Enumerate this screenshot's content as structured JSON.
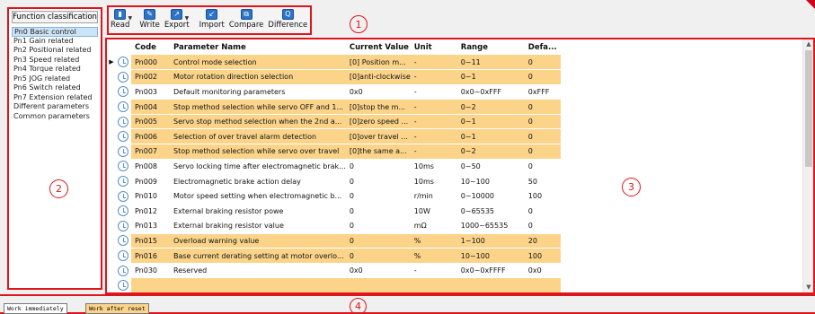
{
  "toolbar": {
    "buttons": [
      {
        "label": "Read",
        "icon": "read-icon",
        "has_dropdown": true
      },
      {
        "label": "Write",
        "icon": "write-icon",
        "has_dropdown": false
      },
      {
        "label": "Export",
        "icon": "export-icon",
        "has_dropdown": true
      },
      {
        "label": "Import",
        "icon": "import-icon",
        "has_dropdown": false
      },
      {
        "label": "Compare",
        "icon": "compare-icon",
        "has_dropdown": false
      },
      {
        "label": "Difference",
        "icon": "difference-icon",
        "has_dropdown": false
      }
    ]
  },
  "callouts": [
    "1",
    "2",
    "3",
    "4"
  ],
  "sidebar": {
    "header": "Function classification",
    "items": [
      {
        "label": "Pn0 Basic control",
        "selected": true
      },
      {
        "label": "Pn1 Gain related",
        "selected": false
      },
      {
        "label": "Pn2 Positional related",
        "selected": false
      },
      {
        "label": "Pn3 Speed related",
        "selected": false
      },
      {
        "label": "Pn4 Torque related",
        "selected": false
      },
      {
        "label": "Pn5 JOG related",
        "selected": false
      },
      {
        "label": "Pn6 Switch related",
        "selected": false
      },
      {
        "label": "Pn7 Extension related",
        "selected": false
      },
      {
        "label": "Different parameters",
        "selected": false
      },
      {
        "label": "Common parameters",
        "selected": false
      }
    ]
  },
  "grid": {
    "columns": [
      "Code",
      "Parameter Name",
      "Current Value",
      "Unit",
      "Range",
      "Defa..."
    ],
    "rows": [
      {
        "code": "Pn000",
        "name": "Control mode selection",
        "value": "[0] Position m...",
        "unit": "-",
        "range": "0~11",
        "default": "0",
        "highlight": true,
        "current": true
      },
      {
        "code": "Pn002",
        "name": "Motor rotation direction selection",
        "value": "[0]anti-clockwise",
        "unit": "-",
        "range": "0~1",
        "default": "0",
        "highlight": true
      },
      {
        "code": "Pn003",
        "name": "Default monitoring parameters",
        "value": "0x0",
        "unit": "-",
        "range": "0x0~0xFFF",
        "default": "0xFFF",
        "highlight": false
      },
      {
        "code": "Pn004",
        "name": "Stop method selection while servo OFF and 1...",
        "value": "[0]stop the m...",
        "unit": "-",
        "range": "0~2",
        "default": "0",
        "highlight": true
      },
      {
        "code": "Pn005",
        "name": "Servo stop method selection when the 2nd a...",
        "value": "[0]zero speed ...",
        "unit": "-",
        "range": "0~1",
        "default": "0",
        "highlight": true
      },
      {
        "code": "Pn006",
        "name": "Selection of over travel alarm detection",
        "value": "[0]over travel ...",
        "unit": "-",
        "range": "0~1",
        "default": "0",
        "highlight": true
      },
      {
        "code": "Pn007",
        "name": "Stop method selection while servo over travel",
        "value": "[0]the same a...",
        "unit": "-",
        "range": "0~2",
        "default": "0",
        "highlight": true
      },
      {
        "code": "Pn008",
        "name": "Servo locking time after electromagnetic brak...",
        "value": "0",
        "unit": "10ms",
        "range": "0~50",
        "default": "0",
        "highlight": false
      },
      {
        "code": "Pn009",
        "name": "Electromagnetic brake action delay",
        "value": "0",
        "unit": "10ms",
        "range": "10~100",
        "default": "50",
        "highlight": false
      },
      {
        "code": "Pn010",
        "name": "Motor speed setting when electromagnetic b...",
        "value": "0",
        "unit": "r/min",
        "range": "0~10000",
        "default": "100",
        "highlight": false
      },
      {
        "code": "Pn012",
        "name": "External braking resistor powe",
        "value": "0",
        "unit": "10W",
        "range": "0~65535",
        "default": "0",
        "highlight": false
      },
      {
        "code": "Pn013",
        "name": "External braking resistor value",
        "value": "0",
        "unit": "mΩ",
        "range": "1000~65535",
        "default": "0",
        "highlight": false
      },
      {
        "code": "Pn015",
        "name": "Overload warning value",
        "value": "0",
        "unit": "%",
        "range": "1~100",
        "default": "20",
        "highlight": true
      },
      {
        "code": "Pn016",
        "name": "Base current derating setting at motor overlo...",
        "value": "0",
        "unit": "%",
        "range": "10~100",
        "default": "100",
        "highlight": true
      },
      {
        "code": "Pn030",
        "name": "Reserved",
        "value": "0x0",
        "unit": "-",
        "range": "0x0~0xFFFF",
        "default": "0x0",
        "highlight": false
      },
      {
        "code": "",
        "name": "",
        "value": "",
        "unit": "",
        "range": "",
        "default": "",
        "highlight": true
      }
    ]
  },
  "bottom_tabs": [
    {
      "label": "Work immediately",
      "color": "#ffffff"
    },
    {
      "label": "Work after reset",
      "color": "#fbd48a"
    }
  ],
  "colors": {
    "highlight": "#fbd48a",
    "callout": "#e0141b",
    "selected": "#cce4f7"
  }
}
